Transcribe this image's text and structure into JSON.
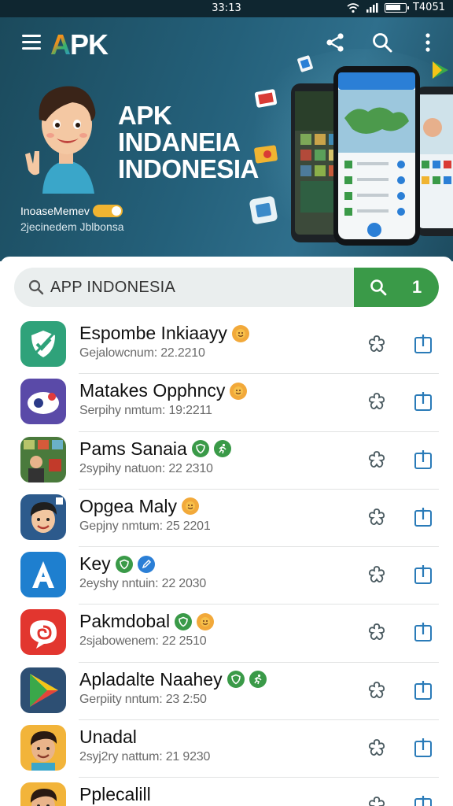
{
  "status_bar": {
    "time": "33:13",
    "battery_text": "T4051"
  },
  "header": {
    "logo": {
      "first": "A",
      "rest": "PK"
    },
    "hero_title": [
      "APK",
      "INDANEIA",
      "INDONESIA"
    ],
    "hero_line1": "InoaseMemev",
    "hero_line2": "2jecinedem Jblbonsa"
  },
  "search": {
    "value": "APP INDONESIA",
    "button_count": "1"
  },
  "apps": [
    {
      "name": "Espombe Inkiaayy",
      "meta": "Gejalowcnum: 22.2210",
      "icon": "green-shield-check-icon",
      "badges": [
        "emoji-badge"
      ]
    },
    {
      "name": "Matakes Opphncy",
      "meta": "Serpihy nmtum: 19:2211",
      "icon": "purple-eye-icon",
      "badges": [
        "emoji-badge"
      ]
    },
    {
      "name": "Pams Sanaia",
      "meta": "2sypihy natuon: 22 2310",
      "icon": "gamer-photo-icon",
      "badges": [
        "shield-badge",
        "runner-badge"
      ]
    },
    {
      "name": "Opgea Maly",
      "meta": "Gepjny nmtum: 25 2201",
      "icon": "boy-avatar-icon",
      "badges": [
        "emoji-badge"
      ]
    },
    {
      "name": "Key",
      "meta": "2eyshy nntuin: 22 2030",
      "icon": "letter-a-icon",
      "badges": [
        "shield-badge",
        "pencil-badge"
      ]
    },
    {
      "name": "Pakmdobal",
      "meta": "2sjabowenem: 22 2510",
      "icon": "red-spiral-icon",
      "badges": [
        "shield-badge",
        "emoji-badge"
      ]
    },
    {
      "name": "Apladalte Naahey",
      "meta": "Gerpiity nntum: 23 2:50",
      "icon": "play-triangle-icon",
      "badges": [
        "shield-badge",
        "runner-badge"
      ]
    },
    {
      "name": "Unadal",
      "meta": "2syj2ry nattum: 21 9230",
      "icon": "man-avatar-icon",
      "badges": []
    },
    {
      "name": "Pplecalill",
      "meta": "",
      "icon": "man-avatar-icon",
      "badges": []
    }
  ],
  "colors": {
    "accent_green": "#3a9a48",
    "hero_bg": "#24607a",
    "badge_blue": "#2b7fd6"
  }
}
